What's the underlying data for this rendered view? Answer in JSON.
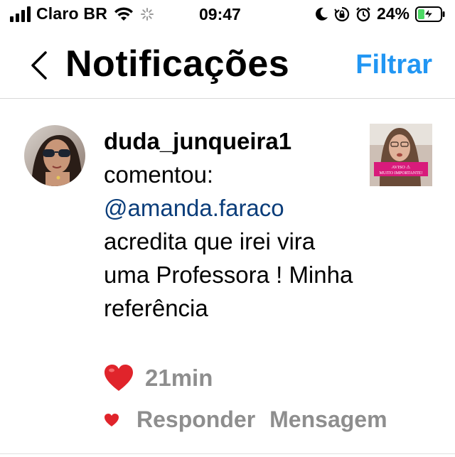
{
  "status_bar": {
    "carrier": "Claro BR",
    "time": "09:47",
    "battery_percent": "24%",
    "icons": [
      "signal-icon",
      "wifi-icon",
      "activity-spinner-icon",
      "moon-icon",
      "orientation-lock-icon",
      "alarm-icon",
      "battery-charging-icon"
    ]
  },
  "header": {
    "title": "Notificações",
    "filter_label": "Filtrar",
    "back_icon": "chevron-left-icon"
  },
  "notification": {
    "username": "duda_junqueira1",
    "action": "comentou:",
    "mention": "@amanda.faraco",
    "comment": "acredita que irei vira uma Professora ! Minha referência",
    "reaction_emoji": "❤️",
    "time_ago": "21min",
    "thumbnail_caption_1": "AVISO ⚠",
    "thumbnail_caption_2": "MUITO IMPORTANTE!",
    "actions": {
      "reply_label": "Responder",
      "message_label": "Mensagem"
    }
  },
  "colors": {
    "accent_blue": "#2196f3",
    "mention_blue": "#0a3d7a",
    "like_red": "#e0242b",
    "muted_gray": "#8e8e8e",
    "battery_green": "#4cd964"
  }
}
